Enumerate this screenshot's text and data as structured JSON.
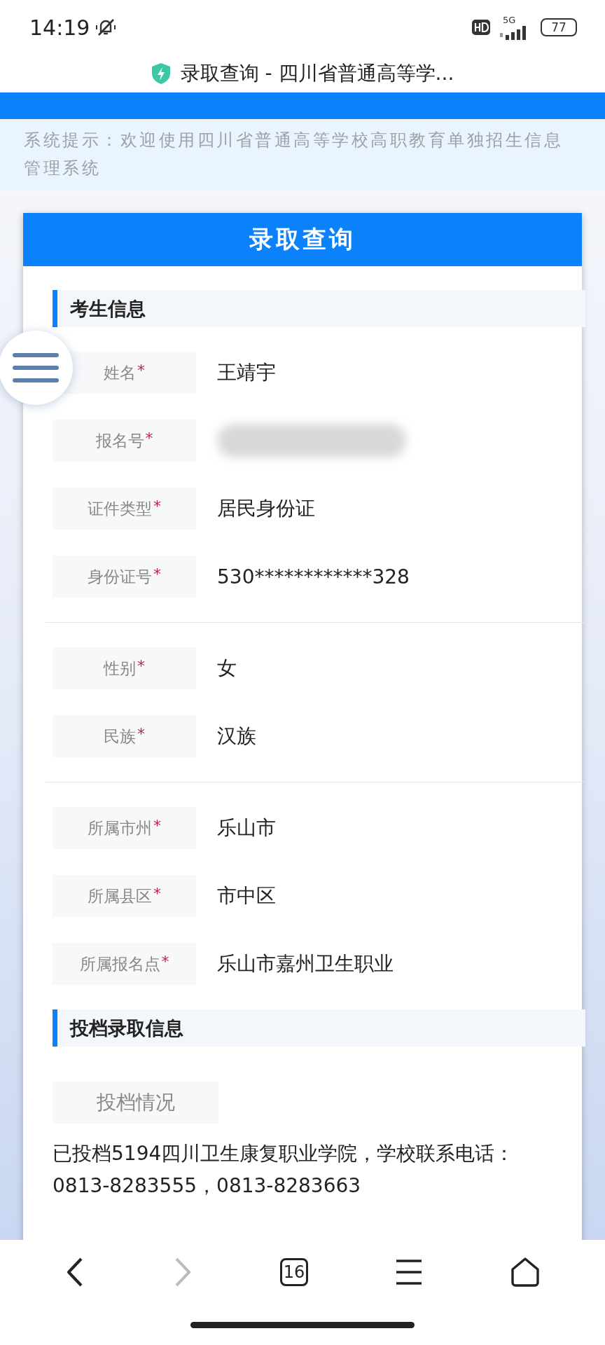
{
  "status_bar": {
    "time": "14:19",
    "network": "5G",
    "battery": "77"
  },
  "browser": {
    "title": "录取查询 - 四川省普通高等学..."
  },
  "notice": "系统提示：欢迎使用四川省普通高等学校高职教育单独招生信息管理系统",
  "card": {
    "title": "录取查询",
    "sections": [
      {
        "title": "考生信息",
        "groups": [
          [
            {
              "label": "姓名",
              "mark": "*",
              "kind": "text",
              "value": "王靖宇"
            },
            {
              "label": "报名号",
              "mark": "*",
              "kind": "blurred"
            },
            {
              "label": "证件类型",
              "mark": "*",
              "kind": "text",
              "value": "居民身份证"
            },
            {
              "label": "身份证号",
              "mark": "*",
              "kind": "text",
              "value": "530************328"
            }
          ],
          [
            {
              "label": "性别",
              "mark": "*",
              "kind": "text",
              "value": "女"
            },
            {
              "label": "民族",
              "mark": "*",
              "kind": "text",
              "value": "汉族"
            }
          ],
          [
            {
              "label": "所属市州",
              "mark": "*",
              "kind": "text",
              "value": "乐山市"
            },
            {
              "label": "所属县区",
              "mark": "*",
              "kind": "text",
              "value": "市中区"
            },
            {
              "label": "所属报名点",
              "mark": "*",
              "kind": "text",
              "value": "乐山市嘉州卫生职业"
            }
          ]
        ]
      },
      {
        "title": "投档录取信息",
        "status_label": "投档情况",
        "status_text": "已投档5194四川卫生康复职业学院，学校联系电话：0813-8283555，0813-8283663"
      }
    ]
  },
  "bottom_nav": {
    "tabs_count": "16"
  }
}
